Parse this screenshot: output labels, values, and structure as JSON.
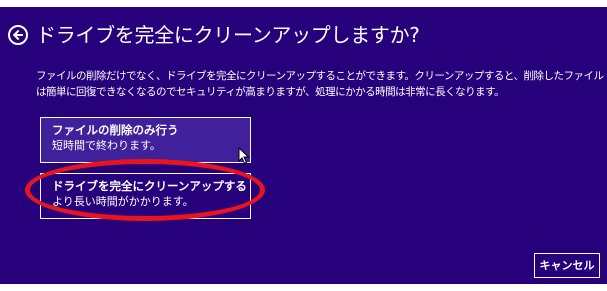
{
  "dialog": {
    "title": "ドライブを完全にクリーンアップしますか?",
    "description": "ファイルの削除だけでなく、ドライブを完全にクリーンアップすることができます。クリーンアップすると、削除したファイルは簡単に回復できなくなるのでセキュリティが高まりますが、処理にかかる時間は非常に長くなります。"
  },
  "options": [
    {
      "title": "ファイルの削除のみ行う",
      "subtitle": "短時間で終わります。"
    },
    {
      "title": "ドライブを完全にクリーンアップする",
      "subtitle": "より長い時間がかかります。"
    }
  ],
  "buttons": {
    "cancel": "キャンセル"
  },
  "icons": {
    "back": "back-arrow-icon",
    "cursor": "mouse-pointer-icon"
  },
  "colors": {
    "background": "#27007c",
    "hover_option": "#41209c",
    "annotation_ring": "#e8141e",
    "text": "#ffffff"
  }
}
